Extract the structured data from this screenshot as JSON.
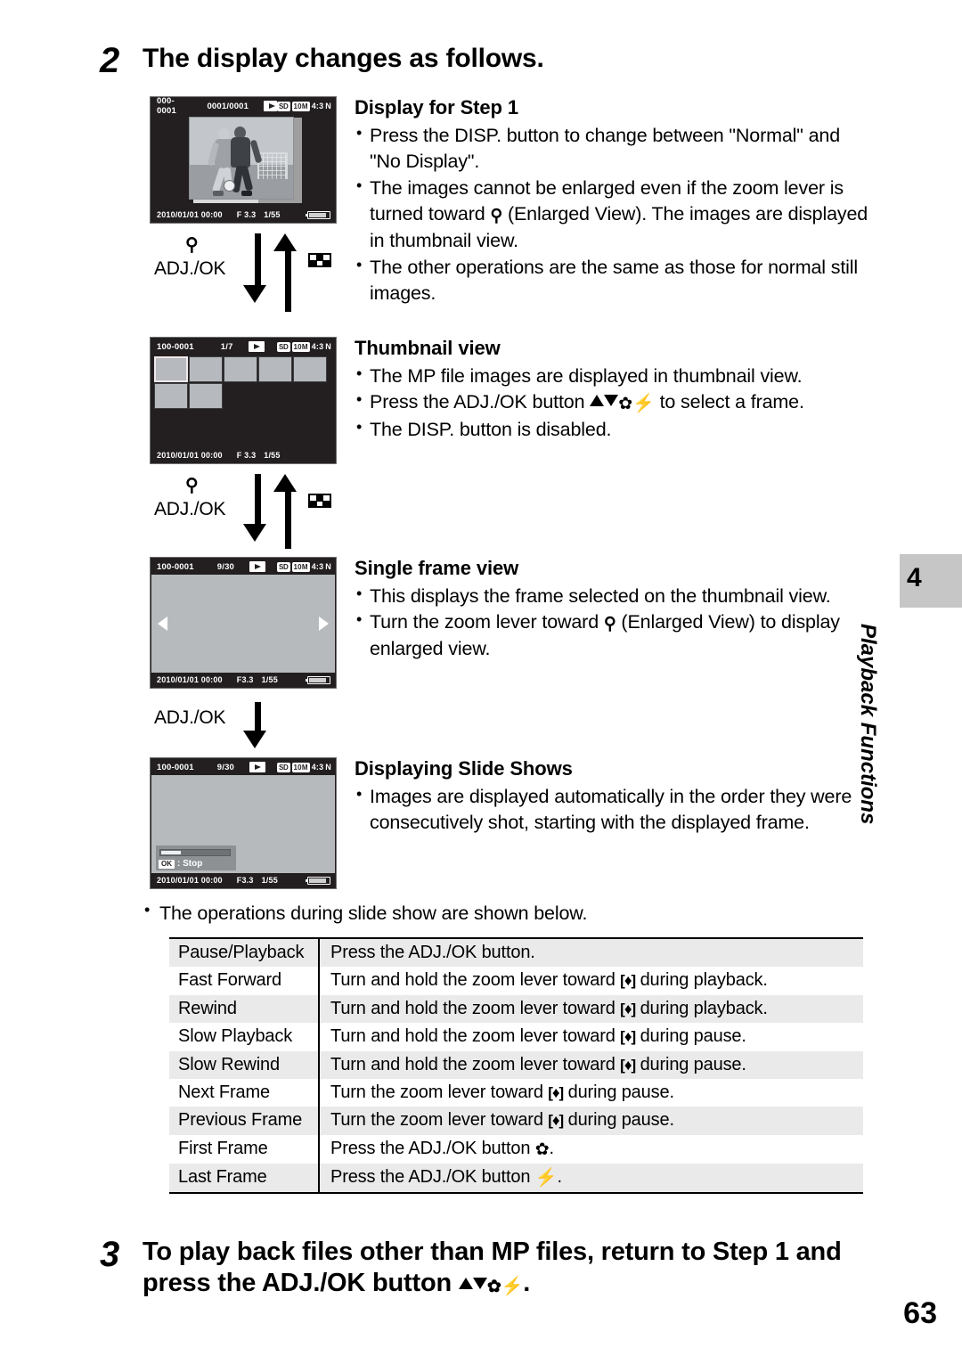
{
  "step2": {
    "number": "2",
    "title": "The display changes as follows."
  },
  "step3": {
    "number": "3",
    "title_part1": "To play back files other than MP files, return to Step 1 and",
    "title_part2_pre": "press the ADJ./OK button",
    "title_part2_post": "."
  },
  "screens": {
    "screen1": {
      "file_number": "000-0001",
      "frame_counter": "0001/0001",
      "play_icon": "play-icon",
      "card_badge": "SD",
      "size_badge": "10M",
      "ratio": "4:3",
      "quality": "N",
      "date": "2010/01/01 00:00",
      "aperture": "F 3.3",
      "shutter": "1/55"
    },
    "screen2": {
      "file_number": "100-0001",
      "frame_counter": "1/7",
      "play_icon": "play-icon",
      "card_badge": "SD",
      "size_badge": "10M",
      "ratio": "4:3",
      "quality": "N",
      "date": "2010/01/01 00:00",
      "aperture": "F 3.3",
      "shutter": "1/55",
      "thumbnail_count": 7,
      "selected_index": 0
    },
    "screen3": {
      "file_number": "100-0001",
      "frame_counter": "9/30",
      "play_icon": "play-icon",
      "card_badge": "SD",
      "size_badge": "10M",
      "ratio": "4:3",
      "quality": "N",
      "date": "2010/01/01 00:00",
      "aperture": "F3.3",
      "shutter": "1/55"
    },
    "screen4": {
      "file_number": "100-0001",
      "frame_counter": "9/30",
      "play_icon": "play-icon",
      "card_badge": "SD",
      "size_badge": "10M",
      "ratio": "4:3",
      "quality": "N",
      "date": "2010/01/01 00:00",
      "aperture": "F3.3",
      "shutter": "1/55",
      "ok_chip": "OK",
      "stop_label": ": Stop",
      "progress_percent": 25
    }
  },
  "connectors": {
    "conn1": {
      "label": "ADJ./OK",
      "magnifier": "⌕"
    },
    "conn2": {
      "label": "ADJ./OK",
      "magnifier": "⌕"
    },
    "conn3": {
      "label": "ADJ./OK"
    }
  },
  "sections": {
    "display_step1": {
      "heading": "Display for Step 1",
      "bullets": [
        {
          "text": "Press the DISP. button to change between \"Normal\" and \"No Display\"."
        },
        {
          "pre": "The images cannot be enlarged even if the zoom lever is turned toward ",
          "icon": "magnifier-icon",
          "post": " (Enlarged View). The images are displayed in thumbnail view."
        },
        {
          "text": "The other operations are the same as those for normal still images."
        }
      ]
    },
    "thumbnail_view": {
      "heading": "Thumbnail view",
      "bullets": [
        {
          "text": "The MP file images are displayed in thumbnail view."
        },
        {
          "pre": "Press the ADJ./OK button ",
          "icons": "up-down-macro-flash",
          "post": " to select a frame."
        },
        {
          "text": "The DISP. button is disabled."
        }
      ]
    },
    "single_frame_view": {
      "heading": "Single frame view",
      "bullets": [
        {
          "text": "This displays the frame selected on the thumbnail view."
        },
        {
          "pre": "Turn the zoom lever toward ",
          "icon": "magnifier-icon",
          "post": " (Enlarged View) to display enlarged view."
        }
      ]
    },
    "slide_shows": {
      "heading": "Displaying Slide Shows",
      "bullets": [
        {
          "text": "Images are displayed automatically in the order they were consecutively shot, starting with the displayed frame."
        }
      ]
    }
  },
  "ops_table": {
    "lead": "The operations during slide show are shown below.",
    "rows": [
      {
        "key": "Pause/Playback",
        "pre": "Press the ADJ./OK button.",
        "icon": "",
        "post": ""
      },
      {
        "key": "Fast Forward",
        "pre": "Turn and hold the zoom lever toward ",
        "icon": "lever-tele",
        "post": " during playback."
      },
      {
        "key": "Rewind",
        "pre": "Turn and hold the zoom lever toward ",
        "icon": "lever-wide",
        "post": " during playback."
      },
      {
        "key": "Slow Playback",
        "pre": "Turn and hold the zoom lever toward ",
        "icon": "lever-tele",
        "post": " during pause."
      },
      {
        "key": "Slow Rewind",
        "pre": "Turn and hold the zoom lever toward ",
        "icon": "lever-wide",
        "post": " during pause."
      },
      {
        "key": "Next Frame",
        "pre": "Turn the zoom lever toward ",
        "icon": "lever-tele",
        "post": " during pause."
      },
      {
        "key": "Previous Frame",
        "pre": "Turn the zoom lever toward ",
        "icon": "lever-wide",
        "post": " during pause."
      },
      {
        "key": "First Frame",
        "pre": "Press the ADJ./OK button ",
        "icon": "macro-icon",
        "post": "."
      },
      {
        "key": "Last Frame",
        "pre": "Press the ADJ./OK button ",
        "icon": "flash-icon",
        "post": "."
      }
    ]
  },
  "sidebar": {
    "chapter_number": "4",
    "chapter_name": "Playback Functions"
  },
  "page_number": "63",
  "colors": {
    "lcd_background": "#231f20",
    "lcd_gray": "#b7babd",
    "table_alt_row": "#eaeaea",
    "chapter_tab": "#c6c6c6"
  }
}
